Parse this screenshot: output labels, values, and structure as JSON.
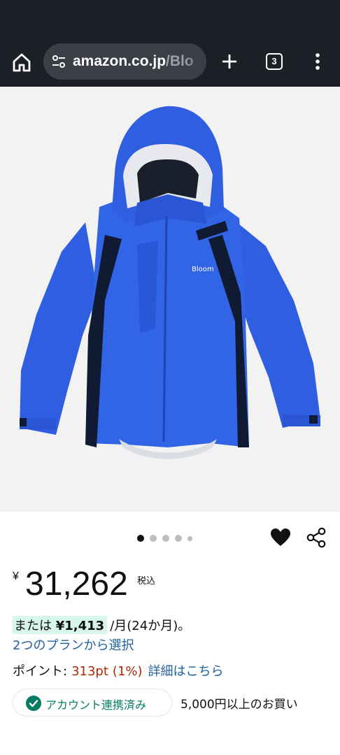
{
  "browser": {
    "url_host": "amazon.co.jp",
    "url_path": "/Blo",
    "tab_count": "3"
  },
  "carousel": {
    "dot_count": 5,
    "active_index": 0
  },
  "product": {
    "image_brand_text": "Bloom",
    "price_symbol": "¥",
    "price": "31,262",
    "tax_label": "税込",
    "installment_prefix": "または",
    "installment_amount": "¥1,413",
    "installment_suffix": "/月(24か月)。",
    "plans_link": "2つのプランから選択",
    "points_label": "ポイント:",
    "points_value": "313pt",
    "points_percent": "(1%)",
    "points_link": "詳細はこちら",
    "account_badge": "アカウント連携済み",
    "promo_text": "5,000円以上のお買い"
  },
  "colors": {
    "accent_link": "#2162a1",
    "price_red": "#b12704",
    "badge_green": "#067d62",
    "jacket_blue": "#2f5ee0"
  },
  "icons": [
    "home-icon",
    "site-settings-icon",
    "new-tab-icon",
    "tab-switcher-icon",
    "more-menu-icon",
    "heart-icon",
    "share-icon",
    "check-circle-icon"
  ]
}
